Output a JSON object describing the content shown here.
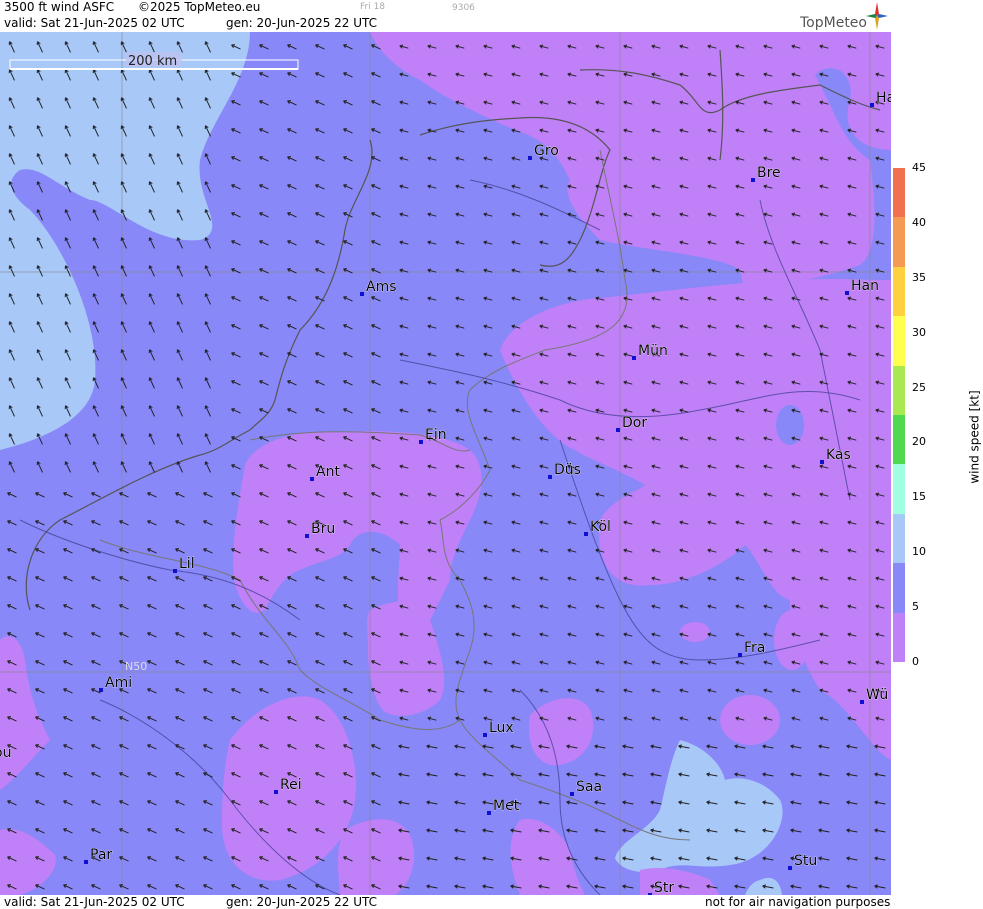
{
  "header": {
    "product": "3500 ft wind ASFC",
    "copyright": "©2025 TopMeteo.eu",
    "faint_day": "Fri 18",
    "faint_code": "9306",
    "valid": "valid:  Sat  21-Jun-2025  02 UTC",
    "generated": "gen: 20-Jun-2025 22 UTC",
    "logo": "TopMeteo"
  },
  "footer": {
    "valid": "valid:  Sat  21-Jun-2025  02 UTC",
    "generated": "gen: 20-Jun-2025 22 UTC",
    "disclaimer": "not for air navigation purposes"
  },
  "map": {
    "scale_label": "200 km",
    "lat_label": "N50",
    "cities": [
      "Gro",
      "Bre",
      "Ha",
      "Han",
      "Ams",
      "Mün",
      "Dor",
      "Ein",
      "Kas",
      "Ant",
      "Düs",
      "Bru",
      "Köl",
      "Lil",
      "Fra",
      "Ami",
      "Wü",
      "Lux",
      "ou",
      "Rei",
      "Saa",
      "Met",
      "Par",
      "Stu",
      "Str"
    ],
    "wind_direction": "easterly / north-easterly flow"
  },
  "legend": {
    "title": "wind speed  [kt]",
    "ticks": [
      "45",
      "40",
      "35",
      "30",
      "25",
      "20",
      "15",
      "10",
      "5",
      "0"
    ],
    "colors": [
      "#f07050",
      "#f49a52",
      "#ffd040",
      "#ffff50",
      "#a8e850",
      "#50d850",
      "#a0ffe0",
      "#a8c8f8",
      "#8888f8",
      "#c080f8"
    ]
  }
}
